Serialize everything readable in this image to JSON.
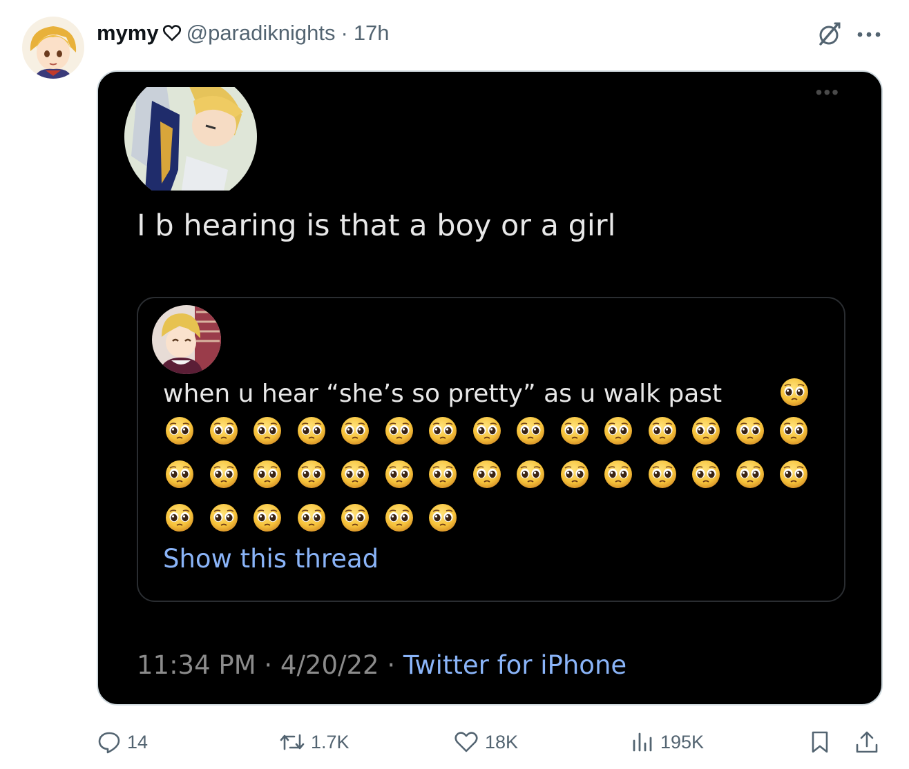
{
  "author": {
    "display_name": "mymy",
    "handle": "@paradiknights",
    "separator": "·",
    "time": "17h"
  },
  "embedded": {
    "text": "I b hearing is that a boy or a girl",
    "quote": {
      "text": "when u hear “she’s so pretty” as u walk past",
      "emoji_rows": [
        15,
        15,
        7
      ],
      "show_thread": "Show this thread"
    },
    "meta": {
      "time": "11:34 PM",
      "sep1": " · ",
      "date": "4/20/22",
      "sep2": " · ",
      "source": "Twitter for iPhone"
    }
  },
  "actions": {
    "replies": "14",
    "reposts": "1.7K",
    "likes": "18K",
    "views": "195K"
  },
  "colors": {
    "link": "#8ab4f8",
    "muted": "#536471",
    "card_bg": "#000000"
  },
  "icons": [
    "heart-icon",
    "grok-icon",
    "more-icon",
    "reply-icon",
    "repost-icon",
    "like-icon",
    "views-icon",
    "bookmark-icon",
    "share-icon"
  ]
}
